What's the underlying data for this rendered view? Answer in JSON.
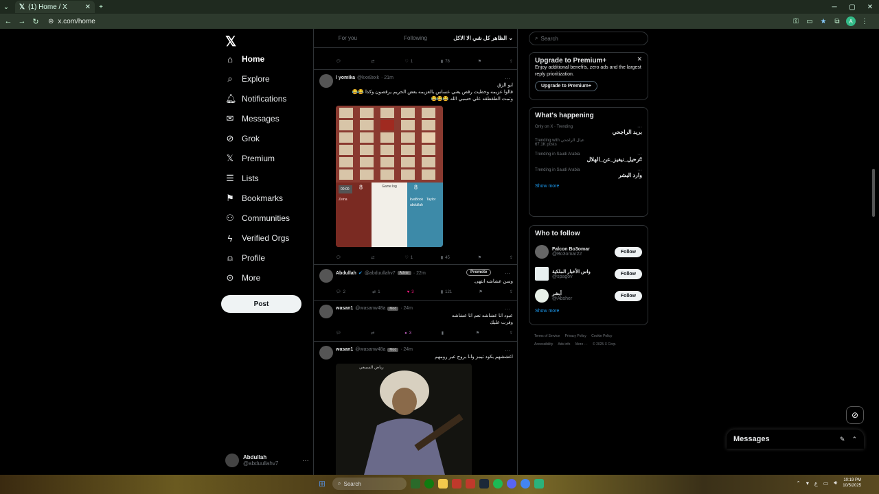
{
  "browser": {
    "tab_title": "(1) Home / X",
    "url": "x.com/home",
    "profile_initial": "A"
  },
  "nav": {
    "items": [
      {
        "label": "Home",
        "icon": "home-icon"
      },
      {
        "label": "Explore",
        "icon": "search-icon"
      },
      {
        "label": "Notifications",
        "icon": "bell-icon"
      },
      {
        "label": "Messages",
        "icon": "mail-icon"
      },
      {
        "label": "Grok",
        "icon": "grok-icon"
      },
      {
        "label": "Premium",
        "icon": "x-icon"
      },
      {
        "label": "Lists",
        "icon": "list-icon"
      },
      {
        "label": "Bookmarks",
        "icon": "bookmark-icon"
      },
      {
        "label": "Communities",
        "icon": "communities-icon"
      },
      {
        "label": "Verified Orgs",
        "icon": "bolt-icon"
      },
      {
        "label": "Profile",
        "icon": "user-icon"
      },
      {
        "label": "More",
        "icon": "more-icon"
      }
    ],
    "post_label": "Post",
    "account": {
      "name": "Abdullah",
      "handle": "@abduullahv7"
    }
  },
  "timeline": {
    "tabs": [
      "For you",
      "Following",
      "الظاهر كل شي الا الاكل"
    ],
    "tweets": [
      {
        "actions": {
          "reply": "",
          "retweet": "",
          "like": "1",
          "views": "78"
        }
      },
      {
        "name": "l yomika",
        "handle": "@kxx8xxk",
        "time": "· 21m",
        "text": [
          "ابو الزق",
          "قالوا عزيمه وحطيت رقص يعني عساس بالعزيمه بعض الحريم يرقصون وكذا 😂😂",
          "وتمت الطقطقه علي حسبي الله 😂😂😂"
        ],
        "actions": {
          "reply": "",
          "retweet": "",
          "like": "1",
          "views": "45"
        },
        "image": {
          "scores": [
            "8",
            "8"
          ],
          "timer": "00:00",
          "log_title": "Game log",
          "names_left": [
            "Zeina"
          ],
          "names_right": [
            "kvaBook",
            "Taylor",
            "abdullah"
          ]
        }
      },
      {
        "name": "Abdullah",
        "handle": "@abduullahv7",
        "badge": "Admin",
        "time": "· 22m",
        "promote": "Promote",
        "text": [
          "وسن عشاشه انتهى."
        ],
        "actions": {
          "reply": "2",
          "retweet": "1",
          "like": "3",
          "views": "121"
        }
      },
      {
        "name": "wasan1",
        "handle": "@wasanw48a",
        "badge": "Mod",
        "time": "· 24m",
        "text": [
          "عبود انا عشاشه نعم انا عشاشه",
          "وفزت عليك"
        ],
        "actions": {
          "reply": "",
          "retweet": "",
          "like": "3",
          "views": ""
        }
      },
      {
        "name": "wasan1",
        "handle": "@wasanw48a",
        "badge": "Mod",
        "time": "· 24m",
        "text": [
          "اغششهم بكود تيمز وانا بروح عبر رومهم"
        ],
        "photo_caption": "رياض السبيعي"
      }
    ]
  },
  "sidebar": {
    "search_placeholder": "Search",
    "premium": {
      "title": "Upgrade to Premium+",
      "desc": "Enjoy additional benefits, zero ads and the largest reply prioritization.",
      "button": "Upgrade to Premium+"
    },
    "happening": {
      "title": "What's happening",
      "trends": [
        {
          "context": "Only on X · Trending",
          "title": "بريد الراجحي",
          "posts": ""
        },
        {
          "context": "Trending with عيال الراجحي",
          "title": "",
          "posts": "67.1K posts"
        },
        {
          "context": "Trending in Saudi Arabia",
          "title": "#رحيل_نيفيز_عن_الهلال",
          "posts": ""
        },
        {
          "context": "Trending in Saudi Arabia",
          "title": "وارد البشر",
          "posts": ""
        }
      ],
      "show_more": "Show more"
    },
    "who_to_follow": {
      "title": "Who to follow",
      "accounts": [
        {
          "name": "Falcon Bo3omar",
          "handle": "@Bo3omar22",
          "button": "Follow"
        },
        {
          "name": "واس الأخبار الملكية",
          "handle": "@spagov",
          "button": "Follow"
        },
        {
          "name": "أبشر",
          "handle": "@Absher",
          "button": "Follow"
        }
      ],
      "show_more": "Show more"
    },
    "footer": [
      "Terms of Service",
      "Privacy Policy",
      "Cookie Policy",
      "Accessibility",
      "Ads info",
      "More ···",
      "© 2025 X Corp."
    ]
  },
  "messages_drawer": {
    "title": "Messages"
  },
  "taskbar": {
    "search": "Search",
    "time": "10:19 PM",
    "date": "10/5/2025"
  },
  "colors": {
    "accent": "#1d9bf0",
    "like": "#f91880",
    "background": "#000000",
    "border": "#2f3336"
  }
}
